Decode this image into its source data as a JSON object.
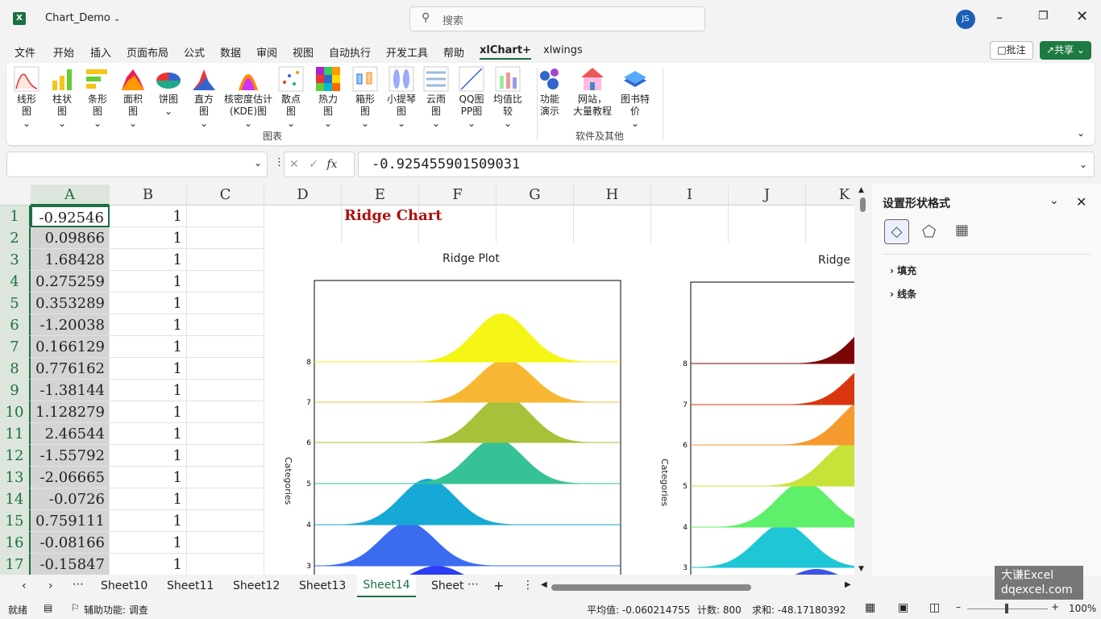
{
  "titlebar": {
    "filename": "Chart_Demo",
    "search_placeholder": "搜索",
    "avatar_initials": "JS"
  },
  "menu": {
    "items": [
      "文件",
      "开始",
      "插入",
      "页面布局",
      "公式",
      "数据",
      "审阅",
      "视图",
      "自动执行",
      "开发工具",
      "帮助",
      "xlChart+",
      "xlwings"
    ],
    "active": "xlChart+",
    "comment_button": "批注",
    "share_button": "共享"
  },
  "ribbon": {
    "buttons": [
      {
        "line1": "线形",
        "line2": "图"
      },
      {
        "line1": "柱状",
        "line2": "图"
      },
      {
        "line1": "条形",
        "line2": "图"
      },
      {
        "line1": "面积",
        "line2": "图"
      },
      {
        "line1": "饼图",
        "line2": ""
      },
      {
        "line1": "直方",
        "line2": "图"
      },
      {
        "line1": "核密度估计",
        "line2": "(KDE)图"
      },
      {
        "line1": "散点",
        "line2": "图"
      },
      {
        "line1": "热力",
        "line2": "图"
      },
      {
        "line1": "箱形",
        "line2": "图"
      },
      {
        "line1": "小提琴",
        "line2": "图"
      },
      {
        "line1": "云雨",
        "line2": "图"
      },
      {
        "line1": "QQ图",
        "line2": "PP图"
      },
      {
        "line1": "均值比",
        "line2": "较"
      },
      {
        "line1": "功能",
        "line2": "演示"
      },
      {
        "line1": "网站，",
        "line2": "大量教程"
      },
      {
        "line1": "图书特",
        "line2": "价"
      }
    ],
    "group1_label": "图表",
    "group2_label": "软件及其他"
  },
  "formula": {
    "name_box": "",
    "fx": "fx",
    "value": "-0.925455901509031"
  },
  "grid": {
    "columns": [
      "A",
      "B",
      "C",
      "D",
      "E",
      "F",
      "G",
      "H",
      "I",
      "J",
      "K"
    ],
    "rows": [
      "1",
      "2",
      "3",
      "4",
      "5",
      "6",
      "7",
      "8",
      "9",
      "10",
      "11",
      "12",
      "13",
      "14",
      "15",
      "16",
      "17"
    ],
    "colA": [
      "-0.92546",
      "0.09866",
      "1.68428",
      "0.275259",
      "0.353289",
      "-1.20038",
      "0.166129",
      "0.776162",
      "-1.38144",
      "1.128279",
      "2.46544",
      "-1.55792",
      "-2.06665",
      "-0.0726",
      "0.759111",
      "-0.08166",
      "-0.15847"
    ],
    "colB": [
      "1",
      "1",
      "1",
      "1",
      "1",
      "1",
      "1",
      "1",
      "1",
      "1",
      "1",
      "1",
      "1",
      "1",
      "1",
      "1",
      "1"
    ],
    "sheet_title": "Ridge Chart"
  },
  "chart1": {
    "title": "Ridge Plot",
    "ylabel": "Categories",
    "chart_data": {
      "type": "area",
      "title": "Ridge Plot",
      "ylabel": "Categories",
      "categories_visible": [
        "3",
        "4",
        "5",
        "6",
        "7",
        "8"
      ],
      "colors": [
        "#2a3ef5",
        "#3b6cf0",
        "#17a9d6",
        "#36c296",
        "#a6c23a",
        "#f8b733",
        "#f5f516"
      ]
    }
  },
  "chart2": {
    "title": "Ridge P",
    "ylabel": "Categories",
    "chart_data": {
      "type": "area",
      "ylabel": "Categories",
      "categories_visible": [
        "3",
        "4",
        "5",
        "6",
        "7",
        "8"
      ],
      "colors": [
        "#3c55e8",
        "#1fc6d6",
        "#5ef06a",
        "#c9e23a",
        "#f59a2c",
        "#d9360f",
        "#7a0606"
      ]
    }
  },
  "panel": {
    "title": "设置形状格式",
    "sections": [
      "填充",
      "线条"
    ]
  },
  "tabs": {
    "items": [
      "Sheet10",
      "Sheet11",
      "Sheet12",
      "Sheet13",
      "Sheet14",
      "Sheet"
    ],
    "active": "Sheet14"
  },
  "status": {
    "ready": "就绪",
    "accessibility": "辅助功能: 调查",
    "average": "平均值: -0.060214755",
    "count": "计数: 800",
    "sum": "求和: -48.17180392",
    "zoom": "100%"
  },
  "watermark": {
    "line1": "大谦Excel",
    "line2": "dqexcel.com"
  }
}
